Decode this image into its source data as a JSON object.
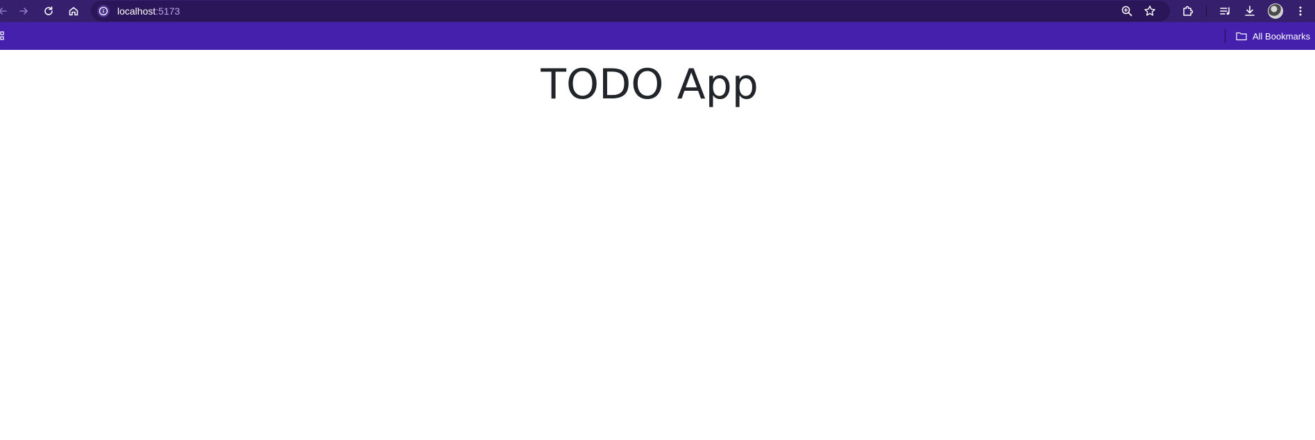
{
  "browser": {
    "url_host": "localhost",
    "url_port": ":5173",
    "bookmarks_label": "All Bookmarks",
    "colors": {
      "toolbar": "#36206e",
      "omnibox": "#2a1658",
      "bookmarks_bar": "#4520ad"
    },
    "icons": {
      "back": "arrow-left-icon",
      "forward": "arrow-right-icon",
      "reload": "reload-icon",
      "home": "home-icon",
      "site_info": "info-icon",
      "zoom": "zoom-icon",
      "bookmark": "star-icon",
      "extensions": "puzzle-icon",
      "reading_list": "reading-list-icon",
      "downloads": "download-icon",
      "menu": "kebab-menu-icon",
      "folder": "folder-icon",
      "apps": "apps-grid-icon"
    }
  },
  "page": {
    "title": "TODO App",
    "title_color": "#212529"
  }
}
